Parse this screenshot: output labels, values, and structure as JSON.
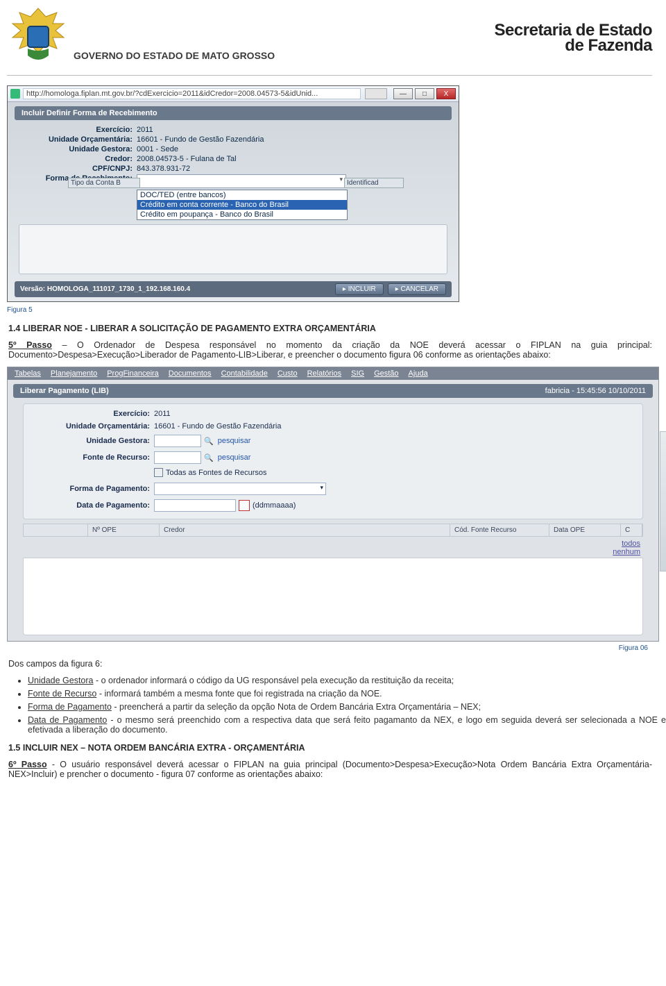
{
  "header": {
    "gov_title": "GOVERNO DO ESTADO DE MATO GROSSO",
    "sefaz_line1": "Secretaria de Estado",
    "sefaz_line2": "de Fazenda"
  },
  "ie_dialog": {
    "url": "http://homologa.fiplan.mt.gov.br/?cdExercicio=2011&idCredor=2008.04573-5&idUnid...",
    "minimize": "—",
    "maximize": "□",
    "close": "X",
    "title": "Incluir Definir Forma de Recebimento",
    "fields": {
      "exercicio_lbl": "Exercício:",
      "exercicio_val": "2011",
      "uo_lbl": "Unidade Orçamentária:",
      "uo_val": "16601 - Fundo de Gestão Fazendária",
      "ug_lbl": "Unidade Gestora:",
      "ug_val": "0001 - Sede",
      "credor_lbl": "Credor:",
      "credor_val": "2008.04573-5 - Fulana de Tal",
      "cpf_lbl": "CPF/CNPJ:",
      "cpf_val": "843.378.931-72",
      "forma_lbl": "Forma de Recebimento:"
    },
    "tipo_conta": "Tipo da Conta   B",
    "identificad": "Identificad",
    "dropdown": {
      "opt1": "DOC/TED (entre bancos)",
      "opt2": "Crédito em conta corrente - Banco do Brasil",
      "opt3": "Crédito em poupança - Banco do Brasil"
    },
    "version": "Versão: HOMOLOGA_111017_1730_1_192.168.160.4",
    "incluir_btn": "▸ INCLUIR",
    "cancelar_btn": "▸ CANCELAR"
  },
  "caption5": "Figura 5",
  "section14": {
    "heading": "1.4 LIBERAR NOE - LIBERAR A SOLICITAÇÃO DE PAGAMENTO EXTRA ORÇAMENTÁRIA",
    "passo_label": "5º Passo",
    "passo_text": " – O Ordenador de Despesa responsável no momento da criação da NOE deverá acessar o FIPLAN na guia principal: Documento>Despesa>Execução>Liberador de Pagamento-LIB>Liberar, e preencher o documento figura 06 conforme as orientações abaixo:"
  },
  "fiplan": {
    "menu": [
      "Tabelas",
      "Planejamento",
      "ProgFinanceira",
      "Documentos",
      "Contabilidade",
      "Custo",
      "Relatórios",
      "SIG",
      "Gestão",
      "Ajuda"
    ],
    "title": "Liberar Pagamento (LIB)",
    "timestamp": "fabricia - 15:45:56 10/10/2011",
    "rows": {
      "ex_lbl": "Exercício:",
      "ex_val": "2011",
      "uo_lbl": "Unidade Orçamentária:",
      "uo_val": "16601 - Fundo de Gestão Fazendária",
      "ug_lbl": "Unidade Gestora:",
      "fonte_lbl": "Fonte de Recurso:",
      "todas_fontes": "Todas as Fontes de Recursos",
      "forma_lbl": "Forma de Pagamento:",
      "data_lbl": "Data de Pagamento:",
      "data_hint": "(ddmmaaaa)",
      "pesquisar": "pesquisar"
    },
    "grid": {
      "nope": "Nº OPE",
      "credor": "Credor",
      "cod": "Cód. Fonte Recurso",
      "data": "Data OPE",
      "c": "C"
    },
    "links": {
      "todos": "todos",
      "nenhum": "nenhum"
    }
  },
  "caption6": "Figura 06",
  "campos_intro": "Dos campos da figura 6:",
  "bullets": {
    "ug_key": "Unidade Gestora",
    "ug_txt": " - o ordenador informará o código da UG responsável pela execução da restituição da receita;",
    "fonte_key": "Fonte de Recurso",
    "fonte_txt": " - informará também a mesma fonte que foi registrada na criação da NOE.",
    "forma_key": "Forma de Pagamento",
    "forma_txt": " - preencherá a partir da seleção da opção Nota de Ordem Bancária Extra Orçamentária – NEX;",
    "data_key": "Data de Pagamento",
    "data_txt": " - o mesmo será preenchido com a respectiva data que será feito pagamanto da NEX, e logo em seguida deverá ser selecionada a NOE e efetivada a liberação do documento."
  },
  "section15": {
    "heading": "1.5   INCLUIR NEX – NOTA ORDEM BANCÁRIA EXTRA - ORÇAMENTÁRIA",
    "passo_label": "6º Passo",
    "passo_text": " - O usuário responsável deverá acessar o FIPLAN na guia principal (Documento>Despesa>Execução>Nota Ordem Bancária Extra Orçamentária-NEX>Incluir) e prencher o documento - figura 07 conforme as orientações abaixo:"
  }
}
